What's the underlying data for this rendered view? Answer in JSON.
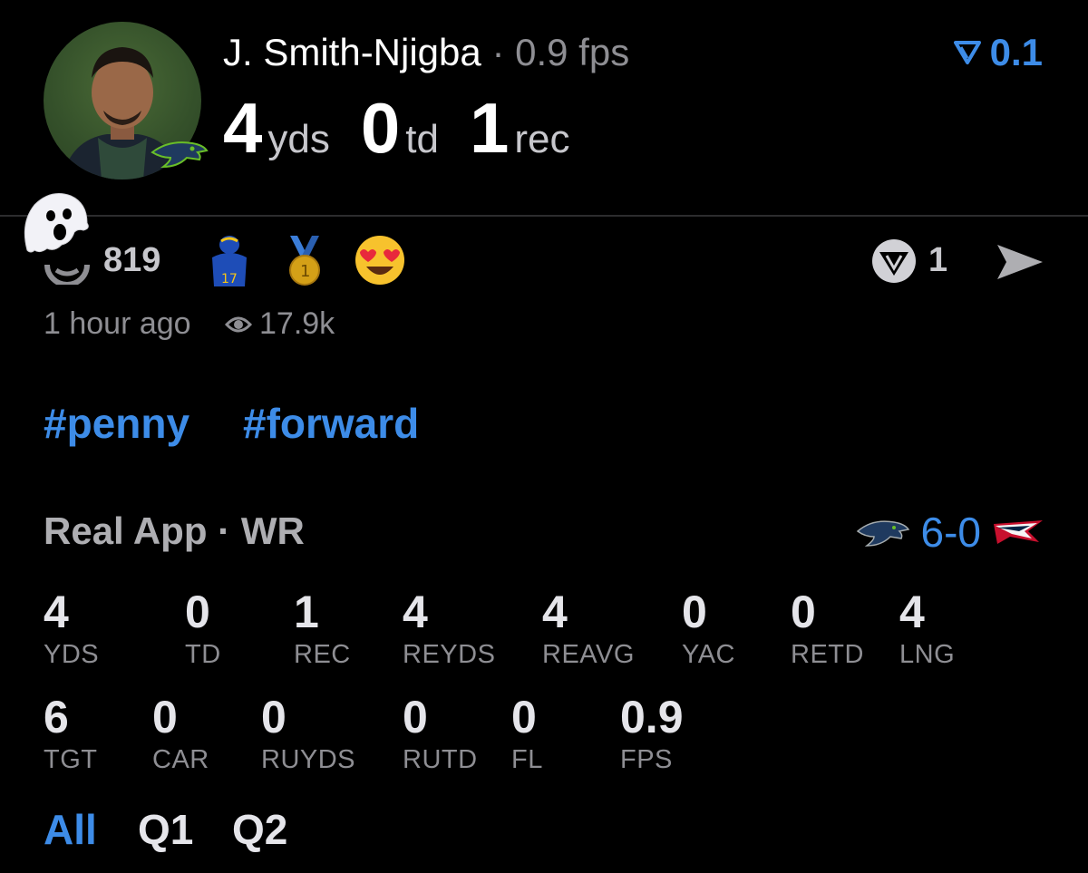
{
  "player": {
    "name": "J. Smith-Njigba",
    "separator": "·",
    "fps": "0.9 fps",
    "team_color": "#002244"
  },
  "headline": {
    "yds_value": "4",
    "yds_unit": "yds",
    "td_value": "0",
    "td_unit": "td",
    "rec_value": "1",
    "rec_unit": "rec"
  },
  "rating": {
    "icon": "filter-triangle-icon",
    "value": "0.1"
  },
  "reactions": {
    "count": "819",
    "emoji": [
      "ghost",
      "mini-player",
      "medal",
      "heart-eyes"
    ],
    "fan_count": "1"
  },
  "meta": {
    "time_ago": "1 hour ago",
    "views": "17.9k"
  },
  "tags": [
    "#penny",
    "#forward"
  ],
  "game": {
    "league": "Real App",
    "separator": "·",
    "position": "WR",
    "score": "6-0",
    "home_team": "Seahawks",
    "away_team": "Patriots"
  },
  "stats_row1": [
    {
      "value": "4",
      "label": "YDS"
    },
    {
      "value": "0",
      "label": "TD"
    },
    {
      "value": "1",
      "label": "REC"
    },
    {
      "value": "4",
      "label": "REYDS"
    },
    {
      "value": "4",
      "label": "REAVG"
    },
    {
      "value": "0",
      "label": "YAC"
    },
    {
      "value": "0",
      "label": "RETD"
    },
    {
      "value": "4",
      "label": "LNG"
    }
  ],
  "stats_row2": [
    {
      "value": "6",
      "label": "TGT"
    },
    {
      "value": "0",
      "label": "CAR"
    },
    {
      "value": "0",
      "label": "RUYDS"
    },
    {
      "value": "0",
      "label": "RUTD"
    },
    {
      "value": "0",
      "label": "FL"
    },
    {
      "value": "0.9",
      "label": "FPS"
    }
  ],
  "quarters": [
    "All",
    "Q1",
    "Q2"
  ],
  "colors": {
    "accent": "#3d8ce8",
    "muted": "#8e8e93",
    "background": "#000000"
  }
}
